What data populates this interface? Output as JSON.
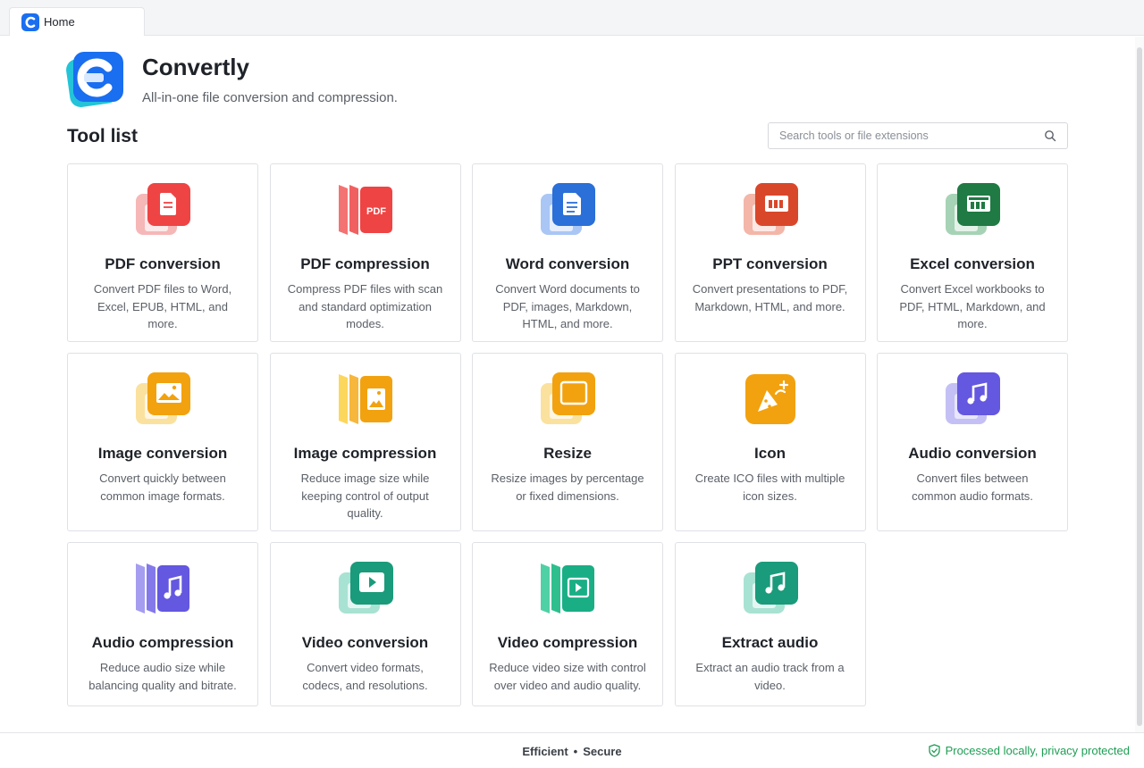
{
  "tab": {
    "label": "Home"
  },
  "app": {
    "name": "Convertly",
    "tagline": "All-in-one file conversion and compression."
  },
  "section_title": "Tool list",
  "search": {
    "placeholder": "Search tools or file extensions",
    "value": ""
  },
  "tools": [
    {
      "title": "PDF conversion",
      "desc": "Convert PDF files to Word, Excel, EPUB, HTML, and more.",
      "icon": "pdf-doc-icon",
      "color": "#ef4444"
    },
    {
      "title": "PDF compression",
      "desc": "Compress PDF files with scan and standard optimization modes.",
      "icon": "pdf-compress-icon",
      "color": "#ef4444",
      "icon_text": "PDF"
    },
    {
      "title": "Word conversion",
      "desc": "Convert Word documents to PDF, images, Markdown, HTML, and more.",
      "icon": "word-doc-icon",
      "color": "#2b6fd8"
    },
    {
      "title": "PPT conversion",
      "desc": "Convert presentations to PDF, Markdown, HTML, and more.",
      "icon": "ppt-icon",
      "color": "#d9472b"
    },
    {
      "title": "Excel conversion",
      "desc": "Convert Excel workbooks to PDF, HTML, Markdown, and more.",
      "icon": "excel-icon",
      "color": "#1f7a43"
    },
    {
      "title": "Image conversion",
      "desc": "Convert quickly between common image formats.",
      "icon": "image-icon",
      "color": "#f2a20f"
    },
    {
      "title": "Image compression",
      "desc": "Reduce image size while keeping control of output quality.",
      "icon": "image-compress-icon",
      "color": "#f2a20f"
    },
    {
      "title": "Resize",
      "desc": "Resize images by percentage or fixed dimensions.",
      "icon": "resize-icon",
      "color": "#f2a20f"
    },
    {
      "title": "Icon",
      "desc": "Create ICO files with multiple icon sizes.",
      "icon": "icon-maker-icon",
      "color": "#f2a20f"
    },
    {
      "title": "Audio conversion",
      "desc": "Convert files between common audio formats.",
      "icon": "audio-icon",
      "color": "#6457e0"
    },
    {
      "title": "Audio compression",
      "desc": "Reduce audio size while balancing quality and bitrate.",
      "icon": "audio-compress-icon",
      "color": "#6457e0"
    },
    {
      "title": "Video conversion",
      "desc": "Convert video formats, codecs, and resolutions.",
      "icon": "video-icon",
      "color": "#1a9b7b"
    },
    {
      "title": "Video compression",
      "desc": "Reduce video size with control over video and audio quality.",
      "icon": "video-compress-icon",
      "color": "#1a9b7b"
    },
    {
      "title": "Extract audio",
      "desc": "Extract an audio track from a video.",
      "icon": "extract-audio-icon",
      "color": "#1a9b7b"
    }
  ],
  "footer": {
    "left_word": "Efficient",
    "separator": "•",
    "right_word": "Secure",
    "privacy": "Processed locally, privacy protected"
  }
}
